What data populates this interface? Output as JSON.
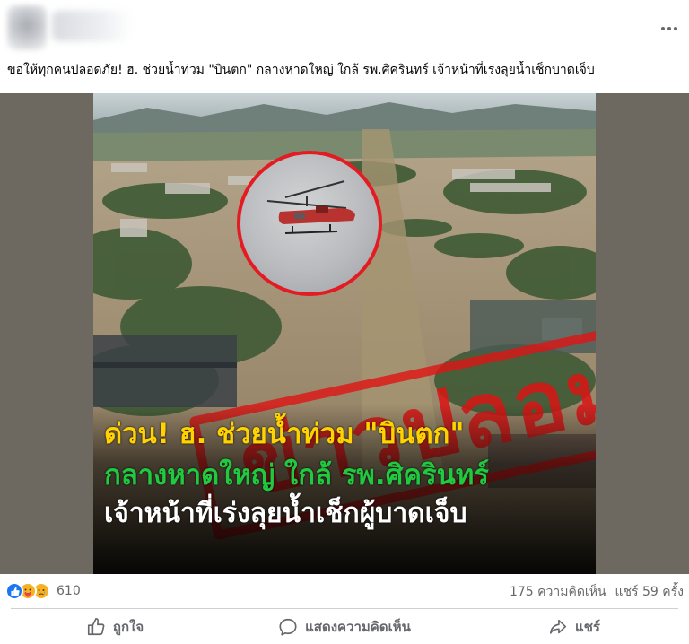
{
  "post": {
    "more_icon": "more-horizontal-icon",
    "caption": "ขอให้ทุกคนปลอดภัย! ฮ. ช่วยน้ำท่วม \"บินตก\" กลางหาดใหญ่ ใกล้ รพ.ศิครินทร์ เจ้าหน้าที่เร่งลุยน้ำเช็กบาดเจ็บ"
  },
  "image": {
    "stamp_text": "ข่าวปลอม",
    "headline_line1": "ด่วน! ฮ. ช่วยน้ำท่วม \"บินตก\"",
    "headline_line2": "กลางหาดใหญ่ ใกล้ รพ.ศิครินทร์",
    "headline_line3": "เจ้าหน้าที่เร่งลุยน้ำเช็กผู้บาดเจ็บ",
    "colors": {
      "stamp": "#e31b23",
      "line1": "#ffd200",
      "line2": "#20c940",
      "line3": "#ffffff"
    }
  },
  "stats": {
    "reaction_icons": [
      "like-icon",
      "care-icon",
      "sad-icon"
    ],
    "reaction_count": "610",
    "comments": "175 ความคิดเห็น",
    "shares": "แชร์ 59 ครั้ง"
  },
  "actions": {
    "like_label": "ถูกใจ",
    "comment_label": "แสดงความคิดเห็น",
    "share_label": "แชร์"
  }
}
